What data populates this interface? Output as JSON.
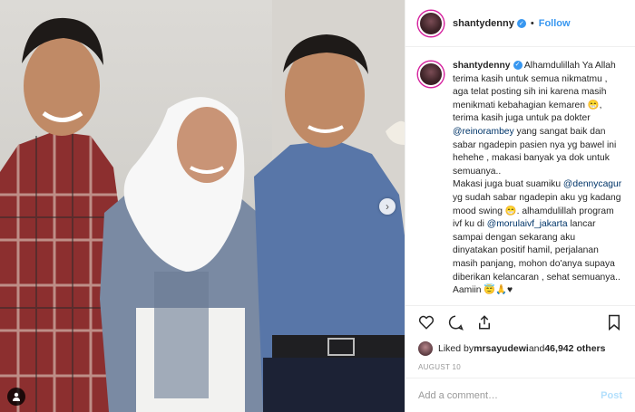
{
  "header": {
    "username": "shantydenny",
    "separator": "•",
    "follow_label": "Follow"
  },
  "caption": {
    "username": "shantydenny",
    "part1": "Alhamdulillah Ya Allah terima kasih untuk semua nikmatmu , aga telat posting sih ini karena masih menikmati kebahagian kemaren 😁, terima kasih juga untuk pa dokter ",
    "mention1": "@reinorambey",
    "part2": " yang sangat baik dan sabar ngadepin pasien nya yg bawel ini hehehe , makasi banyak ya dok untuk semuanya..",
    "part3": "Makasi juga buat suamiku ",
    "mention2": "@dennycagur",
    "part4": " yg sudah sabar ngadepin aku yg kadang mood swing 😁. alhamdulillah program ivf ku di ",
    "mention3": "@morulaivf_jakarta",
    "part5": " lancar sampai dengan sekarang aku dinyatakan positif hamil, perjalanan masih panjang, mohon do'anya supaya diberikan kelancaran , sehat semuanya.. Aamiin 😇🙏♥"
  },
  "likes": {
    "prefix": "Liked by ",
    "user": "mrsayudewi",
    "middle": " and ",
    "count": "46,942 others"
  },
  "date": "AUGUST 10",
  "comment_box": {
    "placeholder": "Add a comment…",
    "post_label": "Post"
  },
  "icons": {
    "like": "heart-icon",
    "comment": "comment-icon",
    "share": "share-icon",
    "save": "bookmark-icon",
    "verified": "verified-badge-icon",
    "next": "chevron-right-icon",
    "tag": "user-tag-icon"
  },
  "colors": {
    "accent": "#3897f0",
    "mention": "#003569",
    "muted": "#999999"
  }
}
